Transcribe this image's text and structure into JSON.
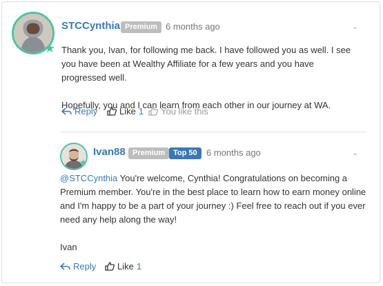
{
  "comment": {
    "author": "STCCynthia",
    "badge": "Premium",
    "time": "6 months ago",
    "paragraph1": "Thank you, Ivan, for following me back. I have followed you as well. I see you have been at Wealthy Affiliate for a few years and you have progressed well.",
    "paragraph2": "Hopefully, you and I can learn from each other in our journey at WA.",
    "reply_label": "Reply",
    "like_label": "Like",
    "like_count": "1",
    "you_like_label": "You like this"
  },
  "reply": {
    "author": "Ivan88",
    "badge_premium": "Premium",
    "badge_rank": "Top 50",
    "time": "6 months ago",
    "mention": "@STCCynthia",
    "text": " You're welcome, Cynthia! Congratulations on becoming a Premium member. You're in the best place to learn how to earn money online and I'm happy to be a part of your journey :) Feel free to reach out if you ever need any help along the way!",
    "signature": "Ivan",
    "reply_label": "Reply",
    "like_label": "Like",
    "like_count": "1"
  },
  "colors": {
    "accent": "#3a77b7",
    "avatar_ring": "#4fc3a1",
    "premium_badge": "#bdbdbd",
    "top50_badge": "#3a77b7"
  },
  "icons": [
    "reply-icon",
    "thumbs-up-icon",
    "star-icon",
    "chevron-down-icon"
  ]
}
